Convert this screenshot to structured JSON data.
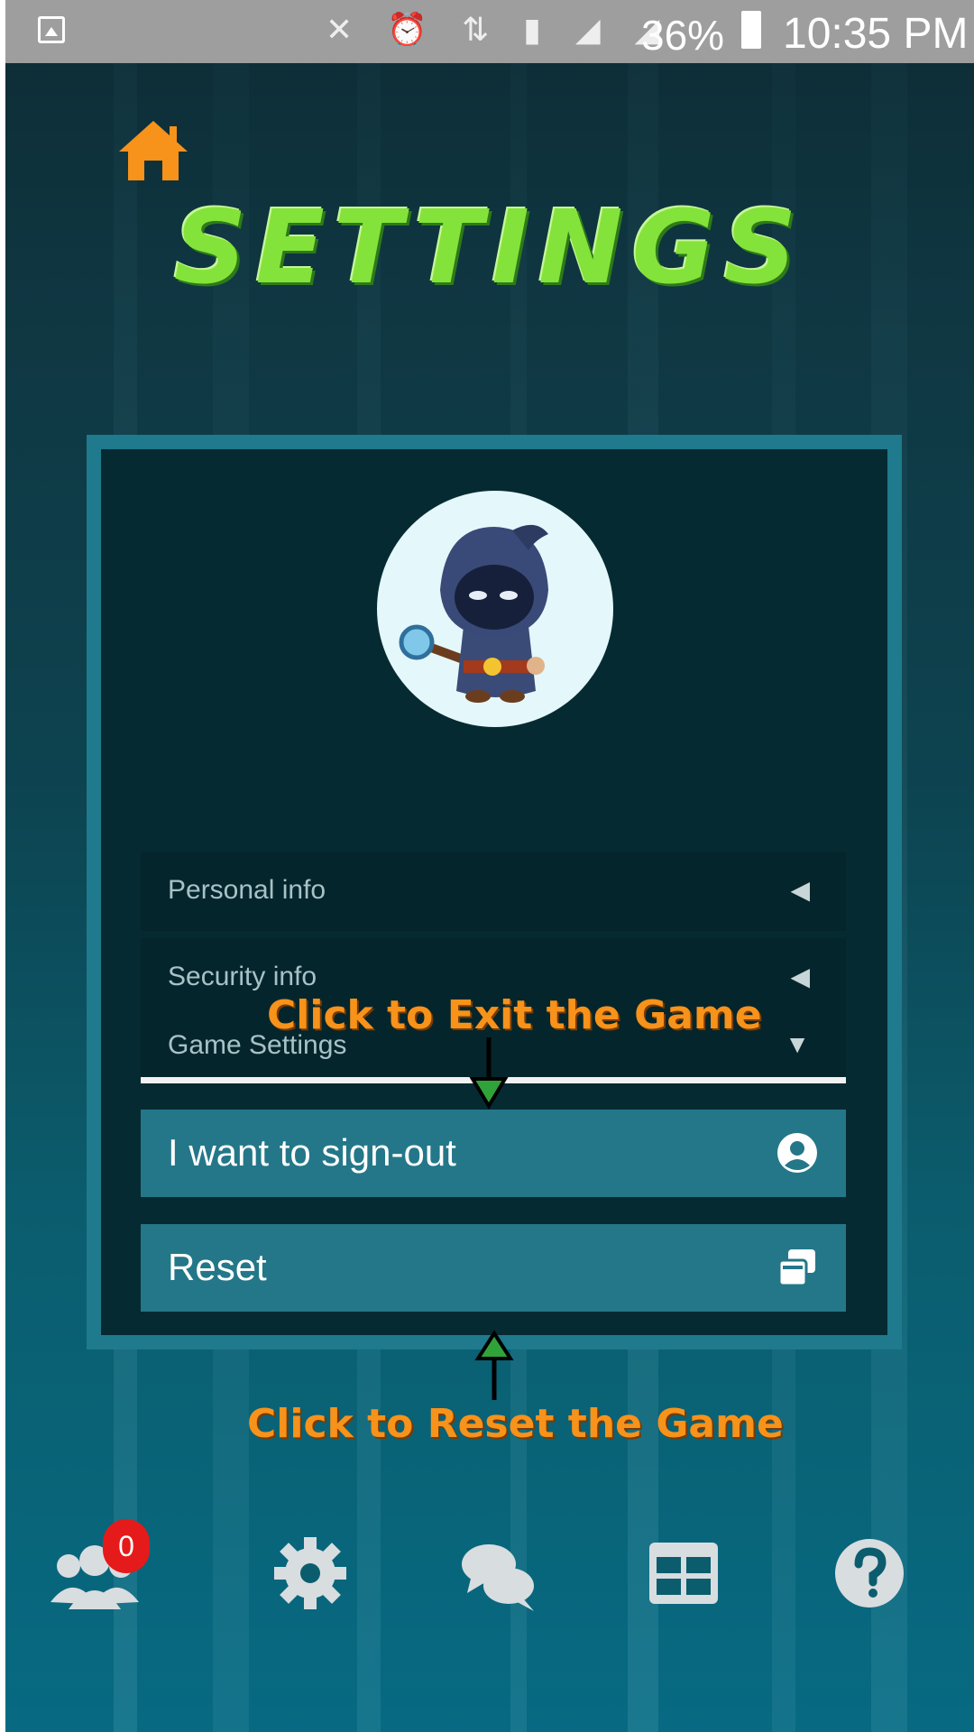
{
  "status_bar": {
    "icons": [
      "image-icon",
      "mute-icon",
      "alarm-icon",
      "data-icon",
      "sim1-icon",
      "signal-icon",
      "signal-icon-2"
    ],
    "battery_text": "36%",
    "time": "10:35 PM"
  },
  "header": {
    "title": "SETTINGS",
    "home_icon": "home-icon"
  },
  "profile": {
    "avatar_icon": "hooded-wizard-avatar"
  },
  "accordion": [
    {
      "label": "Personal info",
      "indicator": "◀"
    },
    {
      "label": "Security info",
      "indicator": "◀"
    },
    {
      "label": "Game Settings",
      "indicator": "▼"
    }
  ],
  "actions": {
    "signout_label": "I want to sign-out",
    "signout_icon": "user-circle-icon",
    "reset_label": "Reset",
    "reset_icon": "windows-restore-icon"
  },
  "hints": {
    "exit": "Click to Exit the Game",
    "reset": "Click to Reset the Game"
  },
  "bottom_nav": {
    "items": [
      "friends-icon",
      "settings-gear-icon",
      "chat-icon",
      "grid-table-icon",
      "help-icon"
    ],
    "friends_badge": "0"
  },
  "colors": {
    "title_green": "#84e33a",
    "hint_orange": "#f7921a",
    "home_orange": "#f7921a",
    "panel_border": "#1e7a8c",
    "button_teal": "#247789",
    "badge_red": "#e51a1a"
  }
}
